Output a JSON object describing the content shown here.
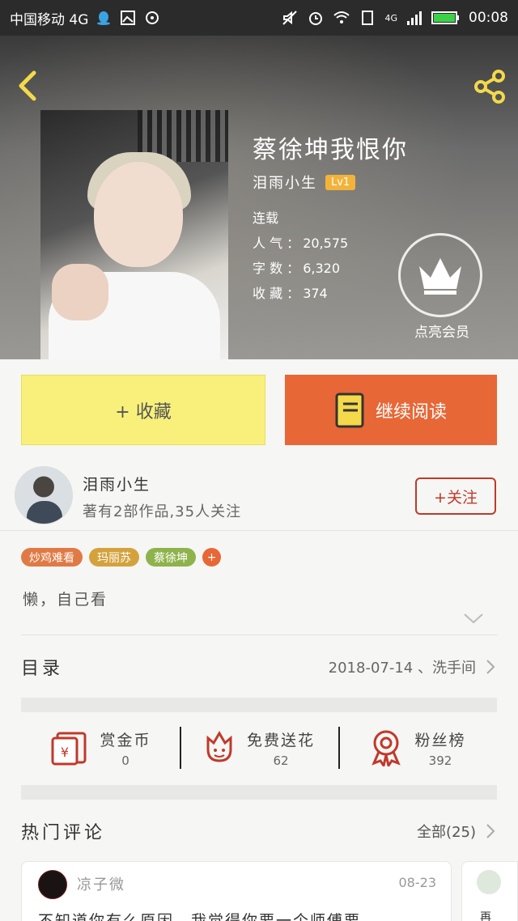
{
  "status_bar": {
    "carrier": "中国移动 4G",
    "network": "4G",
    "time": "00:08"
  },
  "book": {
    "title": "蔡徐坤我恨你",
    "author": "泪雨小生",
    "level": "Lv1",
    "status": "连载",
    "popularity_label": "人 气 ：",
    "popularity": "20,575",
    "words_label": "字 数 ：",
    "words": "6,320",
    "favorites_label": "收 藏 ：",
    "favorites": "374",
    "vip_label": "点亮会员"
  },
  "actions": {
    "collect_label": "+ 收藏",
    "read_label": "继续阅读"
  },
  "author_info": {
    "name": "泪雨小生",
    "stats": "著有2部作品,35人关注",
    "follow_label": "+关注"
  },
  "tags": [
    {
      "label": "炒鸡难看",
      "color": "#e07a45"
    },
    {
      "label": "玛丽苏",
      "color": "#d4a23d"
    },
    {
      "label": "蔡徐坤",
      "color": "#8fb34c"
    },
    {
      "label": "+",
      "color": "#e86736"
    }
  ],
  "description": "懒，自己看",
  "catalog": {
    "label": "目录",
    "latest": "2018-07-14 、洗手间"
  },
  "stats": [
    {
      "label": "赏金币",
      "value": "0",
      "icon": "red-envelope-icon"
    },
    {
      "label": "免费送花",
      "value": "62",
      "icon": "flower-icon"
    },
    {
      "label": "粉丝榜",
      "value": "392",
      "icon": "medal-icon"
    }
  ],
  "comments": {
    "label": "热门评论",
    "all_label": "全部(25)",
    "items": [
      {
        "user": "凉子微",
        "date": "08-23",
        "text": "不知道你有么原因，我觉得你要一个师傅要"
      }
    ],
    "partial_text": "再"
  },
  "colors": {
    "collect_bg": "#f8f07a",
    "read_bg": "#e86736",
    "follow": "#c0392b",
    "badge": "#f3b33a"
  }
}
